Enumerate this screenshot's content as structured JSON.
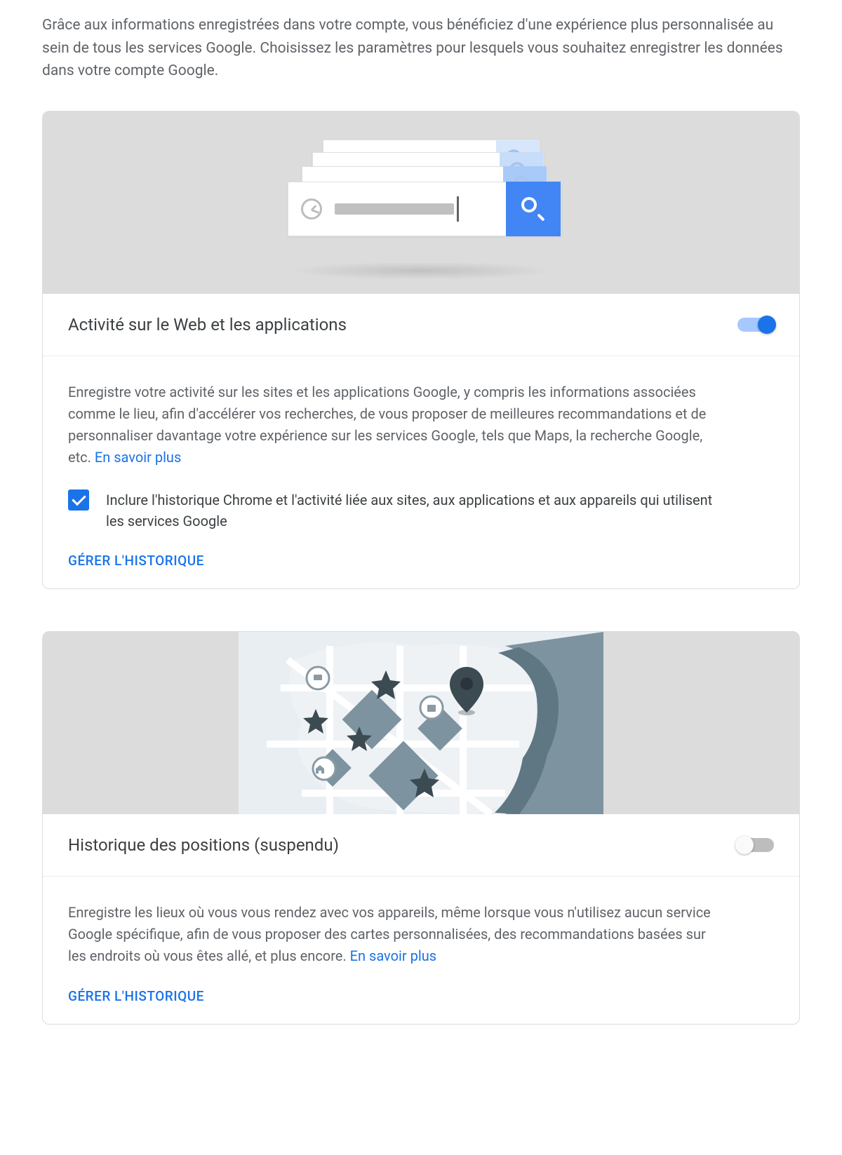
{
  "intro": "Grâce aux informations enregistrées dans votre compte, vous bénéficiez d'une expérience plus personnalisée au sein de tous les services Google. Choisissez les paramètres pour lesquels vous souhaitez enregistrer les données dans votre compte Google.",
  "cards": {
    "web": {
      "title": "Activité sur le Web et les applications",
      "toggle_on": true,
      "description": "Enregistre votre activité sur les sites et les applications Google, y compris les informations associées comme le lieu, afin d'accélérer vos recherches, de vous proposer de meilleures recommandations et de personnaliser davantage votre expérience sur les services Google, tels que Maps, la recherche Google, etc. ",
      "learn_more": "En savoir plus",
      "checkbox_label": "Inclure l'historique Chrome et l'activité liée aux sites, aux applications et aux appareils qui utilisent les services Google",
      "manage": "GÉRER L'HISTORIQUE"
    },
    "location": {
      "title": "Historique des positions (suspendu)",
      "toggle_on": false,
      "description": "Enregistre les lieux où vous vous rendez avec vos appareils, même lorsque vous n'utilisez aucun service Google spécifique, afin de vous proposer des cartes personnalisées, des recommandations basées sur les endroits où vous êtes allé, et plus encore. ",
      "learn_more": "En savoir plus",
      "manage": "GÉRER L'HISTORIQUE"
    }
  }
}
